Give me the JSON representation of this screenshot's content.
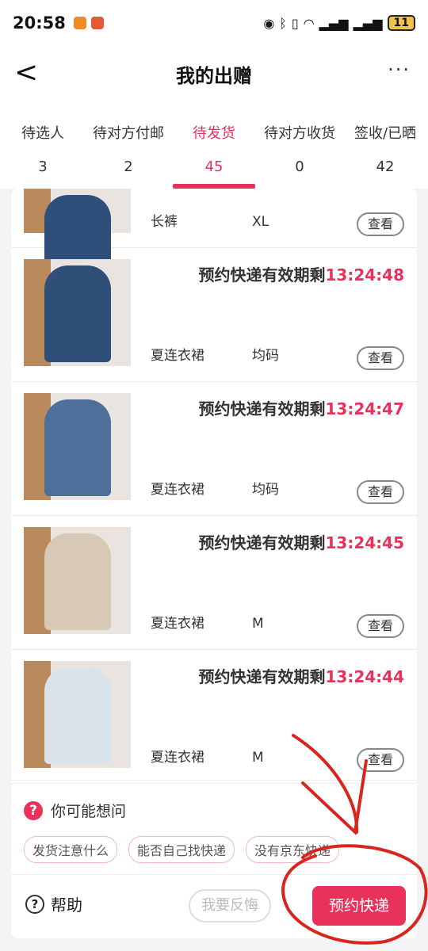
{
  "status_bar": {
    "time": "20:58",
    "notif_colors": [
      "#f08a24",
      "#e45a38"
    ],
    "icons": [
      "eye-icon",
      "bluetooth-icon",
      "vibrate-icon",
      "wifi-icon",
      "signal-4g-icon",
      "signal-4g-icon"
    ],
    "battery": "11"
  },
  "nav": {
    "back_glyph": "<",
    "title": "我的出赠",
    "more_glyph": "···"
  },
  "tabs": [
    {
      "label": "待选人",
      "count": "3",
      "active": false
    },
    {
      "label": "待对方付邮",
      "count": "2",
      "active": false
    },
    {
      "label": "待发货",
      "count": "45",
      "active": true
    },
    {
      "label": "待对方收货",
      "count": "0",
      "active": false
    },
    {
      "label": "签收/已晒",
      "count": "42",
      "active": false
    }
  ],
  "items": [
    {
      "name": "长裤",
      "size": "XL",
      "countdown_label": "",
      "countdown_time": "",
      "view": "查看",
      "garment_color": "#2e4f7a"
    },
    {
      "name": "夏连衣裙",
      "size": "均码",
      "countdown_label": "预约快递有效期剩",
      "countdown_time": "13:24:48",
      "view": "查看",
      "garment_color": "#2f4e78"
    },
    {
      "name": "夏连衣裙",
      "size": "均码",
      "countdown_label": "预约快递有效期剩",
      "countdown_time": "13:24:47",
      "view": "查看",
      "garment_color": "#4d6f99"
    },
    {
      "name": "夏连衣裙",
      "size": "M",
      "countdown_label": "预约快递有效期剩",
      "countdown_time": "13:24:45",
      "view": "查看",
      "garment_color": "#d8c8b6"
    },
    {
      "name": "夏连衣裙",
      "size": "M",
      "countdown_label": "预约快递有效期剩",
      "countdown_time": "13:24:44",
      "view": "查看",
      "garment_color": "#d9e3ec"
    }
  ],
  "faq": {
    "icon": "?",
    "title": "你可能想问",
    "chips": [
      "发货注意什么",
      "能否自己找快递",
      "没有京东快递"
    ]
  },
  "bottom": {
    "help_icon": "?",
    "help_label": "帮助",
    "regret_label": "我要反悔",
    "book_label": "预约快递"
  },
  "accent_color": "#e8315b"
}
